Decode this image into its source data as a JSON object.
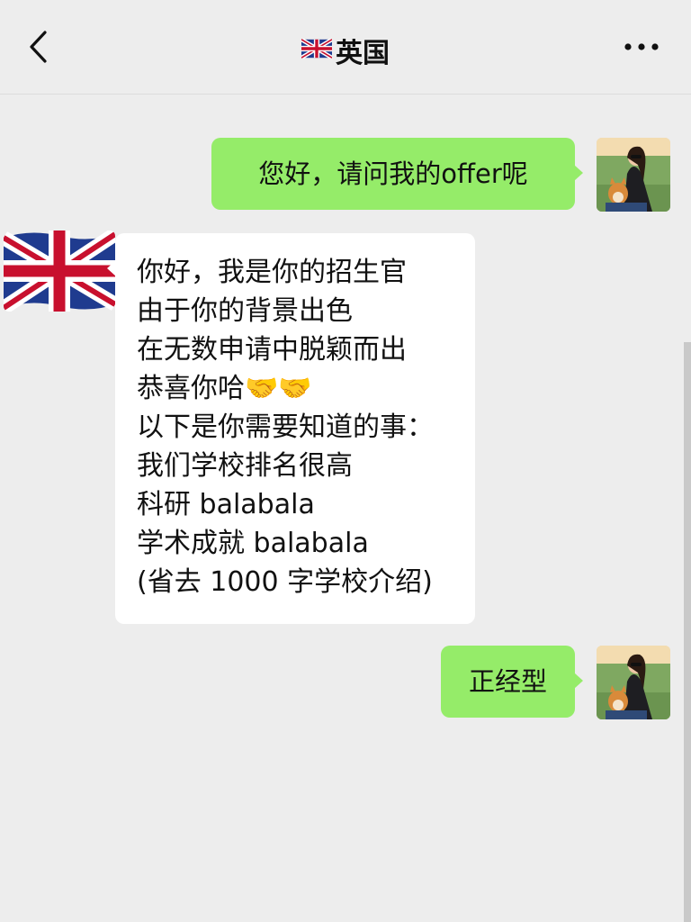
{
  "header": {
    "title": "英国",
    "flag_icon": "uk-flag-icon",
    "back_icon": "chevron-left-icon",
    "more_icon": "more-dots-icon"
  },
  "messages": [
    {
      "sender": "me",
      "text": "您好，请问我的offer呢"
    },
    {
      "sender": "contact",
      "lines": [
        "你好，我是你的招生官",
        "由于你的背景出色",
        "在无数申请中脱颖而出",
        "恭喜你哈🤝🤝",
        "以下是你需要知道的事：",
        "我们学校排名很高",
        "科研 balabala",
        "学术成就 balabala",
        "(省去 1000 字学校介绍)"
      ]
    },
    {
      "sender": "me",
      "text": "正经型"
    }
  ],
  "colors": {
    "background": "#ededed",
    "my_bubble": "#95ec69",
    "their_bubble": "#ffffff"
  }
}
